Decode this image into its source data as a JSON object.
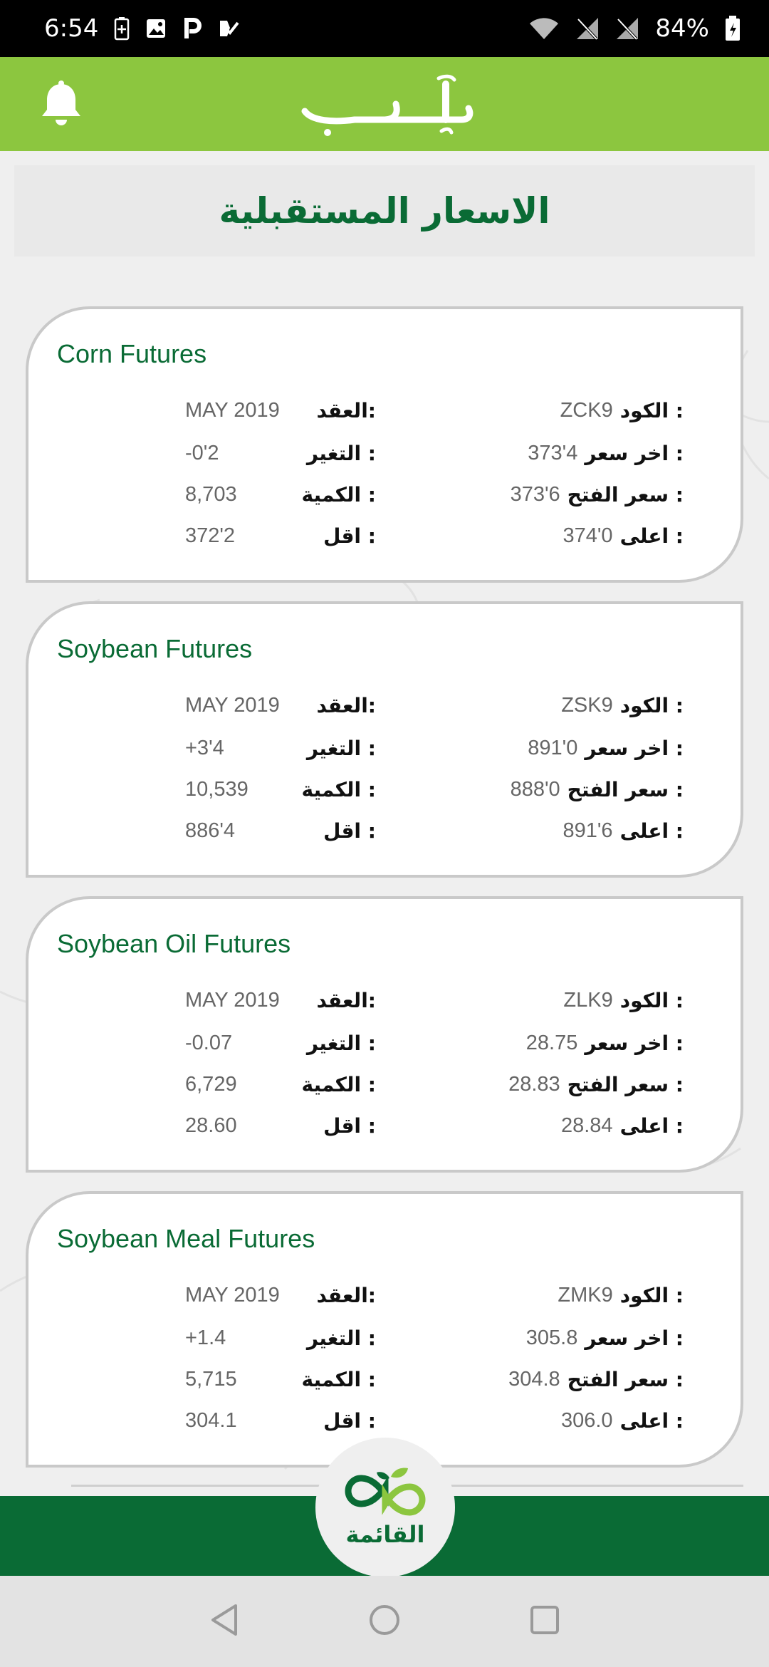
{
  "status_bar": {
    "time": "6:54",
    "battery": "84%"
  },
  "header": {
    "logo_text": "إردب"
  },
  "page": {
    "title": "الاسعار المستقبلية"
  },
  "labels": {
    "code": "الكود :",
    "last_price": "اخر سعر :",
    "open_price": "سعر الفتح :",
    "high": "اعلى :",
    "contract": "العقد:",
    "change": "التغير :",
    "volume": "الكمية :",
    "low": "اقل :"
  },
  "cards": [
    {
      "title": "Corn Futures",
      "code": "ZCK9",
      "last_price": "373'4",
      "open_price": "373'6",
      "high": "374'0",
      "contract": "MAY 2019",
      "change": "-0'2",
      "volume": "8,703",
      "low": "372'2"
    },
    {
      "title": "Soybean Futures",
      "code": "ZSK9",
      "last_price": "891'0",
      "open_price": "888'0",
      "high": "891'6",
      "contract": "MAY 2019",
      "change": "+3'4",
      "volume": "10,539",
      "low": "886'4"
    },
    {
      "title": "Soybean Oil Futures",
      "code": "ZLK9",
      "last_price": "28.75",
      "open_price": "28.83",
      "high": "28.84",
      "contract": "MAY 2019",
      "change": "-0.07",
      "volume": "6,729",
      "low": "28.60"
    },
    {
      "title": "Soybean Meal Futures",
      "code": "ZMK9",
      "last_price": "305.8",
      "open_price": "304.8",
      "high": "306.0",
      "contract": "MAY 2019",
      "change": "+1.4",
      "volume": "5,715",
      "low": "304.1"
    }
  ],
  "bottom_nav": {
    "menu_label": "القائمة"
  },
  "colors": {
    "header_green": "#8cc63f",
    "dark_green": "#0a6b35",
    "background": "#efefef"
  }
}
